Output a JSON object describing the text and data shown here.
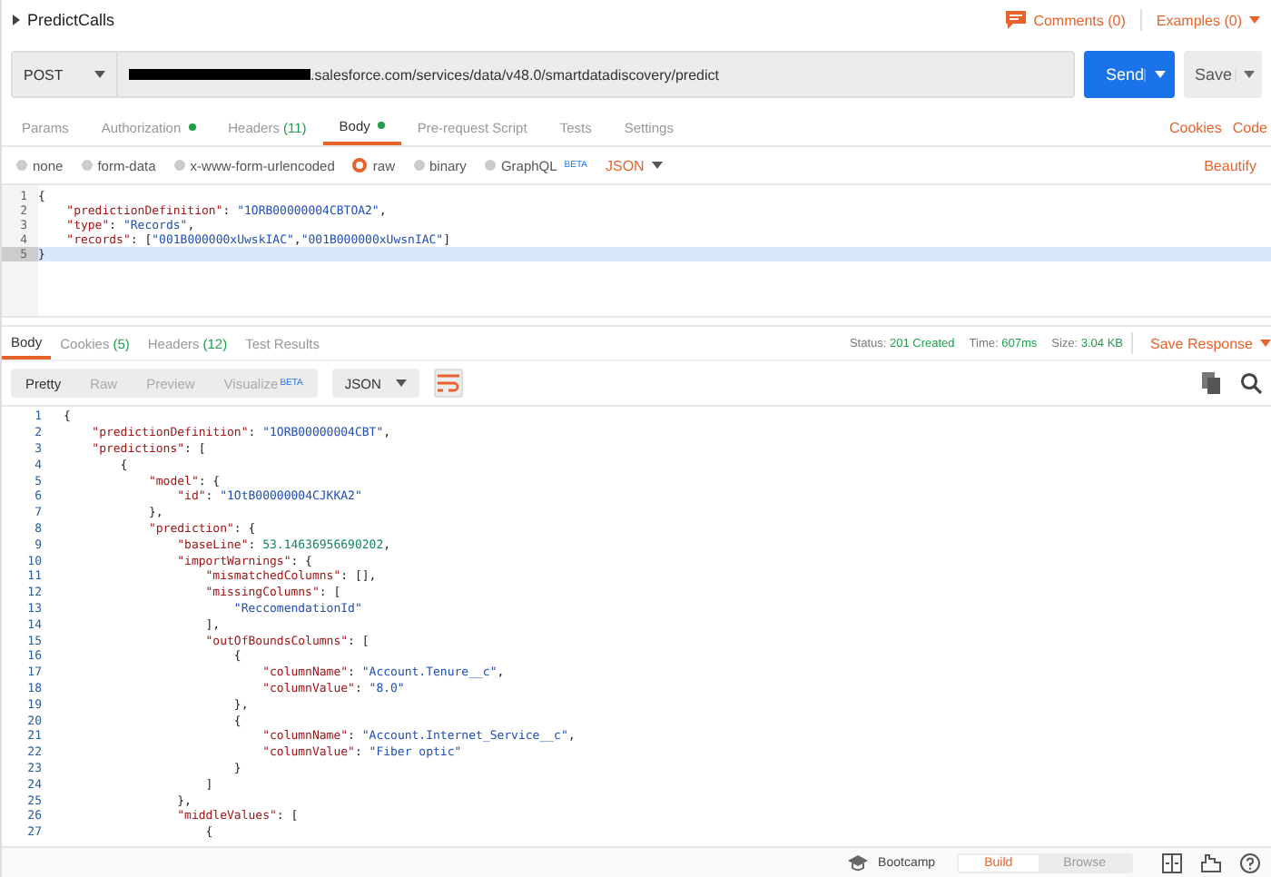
{
  "request": {
    "title": "PredictCalls",
    "comments": "Comments (0)",
    "examples": "Examples (0)",
    "method": "POST",
    "url": ".salesforce.com/services/data/v48.0/smartdatadiscovery/predict",
    "url_redacted": true,
    "send": "Send",
    "save": "Save"
  },
  "request_tabs": [
    {
      "label": "Params",
      "dot": false,
      "selected": false
    },
    {
      "label": "Authorization",
      "dot": true,
      "selected": false
    },
    {
      "label": "Headers",
      "count": "(11)",
      "dot": false,
      "selected": false
    },
    {
      "label": "Body",
      "dot": true,
      "selected": true
    },
    {
      "label": "Pre-request Script",
      "dot": false,
      "selected": false
    },
    {
      "label": "Tests",
      "dot": false,
      "selected": false
    },
    {
      "label": "Settings",
      "dot": false,
      "selected": false
    }
  ],
  "request_links": [
    "Cookies",
    "Code"
  ],
  "body_types": [
    {
      "label": "none",
      "selected": false
    },
    {
      "label": "form-data",
      "selected": false
    },
    {
      "label": "x-www-form-urlencoded",
      "selected": false
    },
    {
      "label": "raw",
      "selected": true
    },
    {
      "label": "binary",
      "selected": false
    },
    {
      "label": "GraphQL",
      "badge": "BETA",
      "selected": false
    }
  ],
  "body_format": "JSON",
  "beautify": "Beautify",
  "request_code": [
    {
      "num": "1",
      "selected": false,
      "tokens": [
        {
          "kind": "punct",
          "text": "{"
        }
      ]
    },
    {
      "num": "2",
      "selected": false,
      "tokens": [
        {
          "kind": "key",
          "text": "    \"predictionDefinition\""
        },
        {
          "kind": "punct",
          "text": ": "
        },
        {
          "kind": "string",
          "text": "\"1ORB00000004CBTOA2\""
        },
        {
          "kind": "punct",
          "text": ","
        }
      ]
    },
    {
      "num": "3",
      "selected": false,
      "tokens": [
        {
          "kind": "key",
          "text": "    \"type\""
        },
        {
          "kind": "punct",
          "text": ": "
        },
        {
          "kind": "string",
          "text": "\"Records\""
        },
        {
          "kind": "punct",
          "text": ","
        }
      ]
    },
    {
      "num": "4",
      "selected": false,
      "tokens": [
        {
          "kind": "key",
          "text": "    \"records\""
        },
        {
          "kind": "punct",
          "text": ": ["
        },
        {
          "kind": "string",
          "text": "\"001B000000xUwskIAC\""
        },
        {
          "kind": "punct",
          "text": ","
        },
        {
          "kind": "string",
          "text": "\"001B000000xUwsnIAC\""
        },
        {
          "kind": "punct",
          "text": "]"
        }
      ]
    },
    {
      "num": "5",
      "selected": true,
      "tokens": [
        {
          "kind": "punct",
          "text": "}"
        }
      ]
    }
  ],
  "response_tabs": [
    {
      "label": "Body",
      "selected": true
    },
    {
      "label": "Cookies",
      "count": "(5)",
      "selected": false
    },
    {
      "label": "Headers",
      "count": "(12)",
      "selected": false
    },
    {
      "label": "Test Results",
      "selected": false
    }
  ],
  "response_stats": [
    {
      "label": "Status:",
      "value": "201 Created"
    },
    {
      "label": "Time:",
      "value": "607ms"
    },
    {
      "label": "Size:",
      "value": "3.04 KB"
    }
  ],
  "save_response": "Save Response",
  "view_modes": [
    {
      "label": "Pretty",
      "selected": true
    },
    {
      "label": "Raw",
      "selected": false
    },
    {
      "label": "Preview",
      "selected": false
    },
    {
      "label": "Visualize",
      "badge": "BETA",
      "selected": false
    }
  ],
  "response_format": "JSON",
  "wrap_on": true,
  "response_code": [
    {
      "num": "1",
      "tokens": [
        {
          "kind": "punct",
          "text": "{"
        }
      ]
    },
    {
      "num": "2",
      "tokens": [
        {
          "kind": "key",
          "text": "    \"predictionDefinition\""
        },
        {
          "kind": "punct",
          "text": ": "
        },
        {
          "kind": "string",
          "text": "\"1ORB00000004CBT\""
        },
        {
          "kind": "punct",
          "text": ","
        }
      ]
    },
    {
      "num": "3",
      "tokens": [
        {
          "kind": "key",
          "text": "    \"predictions\""
        },
        {
          "kind": "punct",
          "text": ": ["
        }
      ]
    },
    {
      "num": "4",
      "tokens": [
        {
          "kind": "punct",
          "text": "        {"
        }
      ]
    },
    {
      "num": "5",
      "tokens": [
        {
          "kind": "key",
          "text": "            \"model\""
        },
        {
          "kind": "punct",
          "text": ": {"
        }
      ]
    },
    {
      "num": "6",
      "tokens": [
        {
          "kind": "key",
          "text": "                \"id\""
        },
        {
          "kind": "punct",
          "text": ": "
        },
        {
          "kind": "string",
          "text": "\"1OtB00000004CJKKA2\""
        }
      ]
    },
    {
      "num": "7",
      "tokens": [
        {
          "kind": "punct",
          "text": "            },"
        }
      ]
    },
    {
      "num": "8",
      "tokens": [
        {
          "kind": "key",
          "text": "            \"prediction\""
        },
        {
          "kind": "punct",
          "text": ": {"
        }
      ]
    },
    {
      "num": "9",
      "tokens": [
        {
          "kind": "key",
          "text": "                \"baseLine\""
        },
        {
          "kind": "punct",
          "text": ": "
        },
        {
          "kind": "number",
          "text": "53.14636956690202"
        },
        {
          "kind": "punct",
          "text": ","
        }
      ]
    },
    {
      "num": "10",
      "tokens": [
        {
          "kind": "key",
          "text": "                \"importWarnings\""
        },
        {
          "kind": "punct",
          "text": ": {"
        }
      ]
    },
    {
      "num": "11",
      "tokens": [
        {
          "kind": "key",
          "text": "                    \"mismatchedColumns\""
        },
        {
          "kind": "punct",
          "text": ": [],"
        }
      ]
    },
    {
      "num": "12",
      "tokens": [
        {
          "kind": "key",
          "text": "                    \"missingColumns\""
        },
        {
          "kind": "punct",
          "text": ": ["
        }
      ]
    },
    {
      "num": "13",
      "tokens": [
        {
          "kind": "string",
          "text": "                        \"ReccomendationId\""
        }
      ]
    },
    {
      "num": "14",
      "tokens": [
        {
          "kind": "punct",
          "text": "                    ],"
        }
      ]
    },
    {
      "num": "15",
      "tokens": [
        {
          "kind": "key",
          "text": "                    \"outOfBoundsColumns\""
        },
        {
          "kind": "punct",
          "text": ": ["
        }
      ]
    },
    {
      "num": "16",
      "tokens": [
        {
          "kind": "punct",
          "text": "                        {"
        }
      ]
    },
    {
      "num": "17",
      "tokens": [
        {
          "kind": "key",
          "text": "                            \"columnName\""
        },
        {
          "kind": "punct",
          "text": ": "
        },
        {
          "kind": "string",
          "text": "\"Account.Tenure__c\""
        },
        {
          "kind": "punct",
          "text": ","
        }
      ]
    },
    {
      "num": "18",
      "tokens": [
        {
          "kind": "key",
          "text": "                            \"columnValue\""
        },
        {
          "kind": "punct",
          "text": ": "
        },
        {
          "kind": "string",
          "text": "\"8.0\""
        }
      ]
    },
    {
      "num": "19",
      "tokens": [
        {
          "kind": "punct",
          "text": "                        },"
        }
      ]
    },
    {
      "num": "20",
      "tokens": [
        {
          "kind": "punct",
          "text": "                        {"
        }
      ]
    },
    {
      "num": "21",
      "tokens": [
        {
          "kind": "key",
          "text": "                            \"columnName\""
        },
        {
          "kind": "punct",
          "text": ": "
        },
        {
          "kind": "string",
          "text": "\"Account.Internet_Service__c\""
        },
        {
          "kind": "punct",
          "text": ","
        }
      ]
    },
    {
      "num": "22",
      "tokens": [
        {
          "kind": "key",
          "text": "                            \"columnValue\""
        },
        {
          "kind": "punct",
          "text": ": "
        },
        {
          "kind": "string",
          "text": "\"Fiber optic\""
        }
      ]
    },
    {
      "num": "23",
      "tokens": [
        {
          "kind": "punct",
          "text": "                        }"
        }
      ]
    },
    {
      "num": "24",
      "tokens": [
        {
          "kind": "punct",
          "text": "                    ]"
        }
      ]
    },
    {
      "num": "25",
      "tokens": [
        {
          "kind": "punct",
          "text": "                },"
        }
      ]
    },
    {
      "num": "26",
      "tokens": [
        {
          "kind": "key",
          "text": "                \"middleValues\""
        },
        {
          "kind": "punct",
          "text": ": ["
        }
      ]
    },
    {
      "num": "27",
      "tokens": [
        {
          "kind": "punct",
          "text": "                    {"
        }
      ]
    }
  ],
  "footer": {
    "bootcamp": "Bootcamp",
    "modes": [
      {
        "label": "Build",
        "selected": true
      },
      {
        "label": "Browse",
        "selected": false
      }
    ]
  }
}
